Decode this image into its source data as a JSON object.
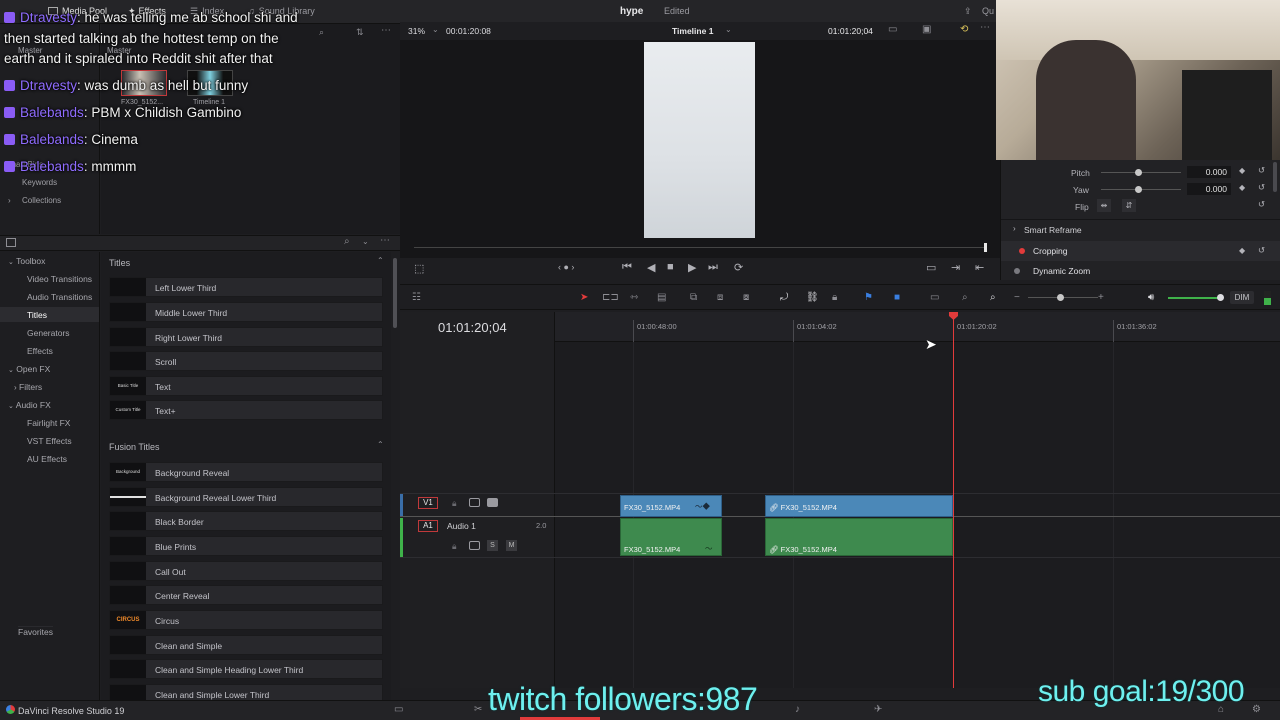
{
  "topbar": {
    "media_pool": "Media Pool",
    "effects": "Effects",
    "index": "Index",
    "sound_library": "Sound Library",
    "qu": "Qu"
  },
  "media_pool": {
    "master_labels": [
      "Master",
      "Master"
    ],
    "clips": [
      {
        "name": "FX30_5152..."
      },
      {
        "name": "Timeline 1"
      }
    ],
    "smart_bins": "Smart Bins",
    "keywords": "Keywords",
    "collections": "Collections"
  },
  "chat": [
    {
      "user": "Dtravesty",
      "message": "he was telling me ab school shi and"
    },
    {
      "user": "",
      "message": "then started talking ab the hottest temp on the"
    },
    {
      "user": "",
      "message": "earth and it spiraled into Reddit shit after that"
    },
    {
      "user": "Dtravesty",
      "message": "was dumb as hell but funny"
    },
    {
      "user": "Balebands",
      "message": "PBM x Childish Gambino"
    },
    {
      "user": "Balebands",
      "message": "Cinema"
    },
    {
      "user": "Balebands",
      "message": "mmmm"
    }
  ],
  "toolbox": {
    "tree": [
      {
        "label": "Toolbox",
        "level": 0,
        "expanded": true,
        "selected": false
      },
      {
        "label": "Video Transitions",
        "level": 1,
        "selected": false
      },
      {
        "label": "Audio Transitions",
        "level": 1,
        "selected": false
      },
      {
        "label": "Titles",
        "level": 1,
        "selected": true
      },
      {
        "label": "Generators",
        "level": 1,
        "selected": false
      },
      {
        "label": "Effects",
        "level": 1,
        "selected": false
      },
      {
        "label": "Open FX",
        "level": 0,
        "expanded": true,
        "selected": false
      },
      {
        "label": "Filters",
        "level": 1,
        "expanded": false,
        "selected": false
      },
      {
        "label": "Audio FX",
        "level": 0,
        "expanded": true,
        "selected": false
      },
      {
        "label": "Fairlight FX",
        "level": 1,
        "selected": false
      },
      {
        "label": "VST Effects",
        "level": 1,
        "selected": false
      },
      {
        "label": "AU Effects",
        "level": 1,
        "selected": false
      }
    ],
    "favorites": "Favorites"
  },
  "titles_section": {
    "heading": "Titles",
    "items": [
      {
        "name": "Left Lower Third",
        "thumb": ""
      },
      {
        "name": "Middle Lower Third",
        "thumb": ""
      },
      {
        "name": "Right Lower Third",
        "thumb": ""
      },
      {
        "name": "Scroll",
        "thumb": ""
      },
      {
        "name": "Text",
        "thumb": "Basic Title"
      },
      {
        "name": "Text+",
        "thumb": "Custom Title"
      }
    ]
  },
  "fusion_section": {
    "heading": "Fusion Titles",
    "items": [
      {
        "name": "Background Reveal",
        "thumb": "Background Reveal"
      },
      {
        "name": "Background Reveal Lower Third",
        "thumb": ""
      },
      {
        "name": "Black Border",
        "thumb": ""
      },
      {
        "name": "Blue Prints",
        "thumb": ""
      },
      {
        "name": "Call Out",
        "thumb": ""
      },
      {
        "name": "Center Reveal",
        "thumb": ""
      },
      {
        "name": "Circus",
        "thumb": "CIRCUS"
      },
      {
        "name": "Clean and Simple",
        "thumb": ""
      },
      {
        "name": "Clean and Simple Heading Lower Third",
        "thumb": ""
      },
      {
        "name": "Clean and Simple Lower Third",
        "thumb": ""
      }
    ]
  },
  "viewer": {
    "project_name": "hype",
    "status": "Edited",
    "zoom": "31%",
    "source_timecode": "00:01:20:08",
    "timeline_name": "Timeline 1",
    "record_timecode": "01:01:20;04"
  },
  "inspector": {
    "pitch_label": "Pitch",
    "pitch_value": "0.000",
    "yaw_label": "Yaw",
    "yaw_value": "0.000",
    "flip_label": "Flip",
    "smart_reframe": "Smart Reframe",
    "cropping": "Cropping",
    "dynamic_zoom": "Dynamic Zoom"
  },
  "timeline": {
    "timecode": "01:01:20;04",
    "ruler": [
      "01:00:48:00",
      "01:01:04:02",
      "01:01:20:02",
      "01:01:36:02"
    ],
    "dim_label": "DIM",
    "tracks": [
      {
        "id": "V1",
        "name": ""
      },
      {
        "id": "A1",
        "name": "Audio 1",
        "channels": "2.0"
      }
    ],
    "clips": [
      {
        "track": "V1",
        "label": "FX30_5152.MP4"
      },
      {
        "track": "V1",
        "label": "FX30_5152.MP4"
      },
      {
        "track": "A1",
        "label": "FX30_5152.MP4"
      },
      {
        "track": "A1",
        "label": "FX30_5152.MP4"
      }
    ],
    "audio_buttons": {
      "solo": "S",
      "mute": "M"
    }
  },
  "app": {
    "name": "DaVinci Resolve Studio 19"
  },
  "stream": {
    "followers": "twitch followers:987",
    "sub_goal": "sub goal:19/300"
  },
  "colors": {
    "accent_red": "#e23b3b",
    "video_clip": "#4b88b8",
    "audio_clip": "#3e8a4e",
    "overlay_text": "#6ef0ef",
    "chat_user": "#8f6cff"
  }
}
